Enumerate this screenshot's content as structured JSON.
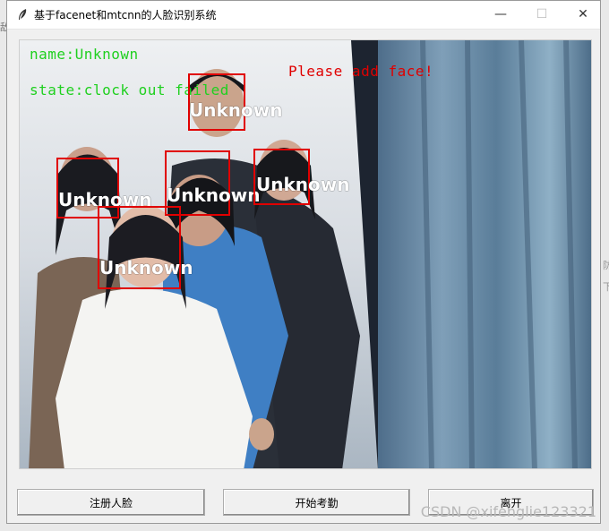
{
  "window": {
    "title": "基于facenet和mtcnn的人脸识别系统",
    "controls": {
      "minimize": "—",
      "maximize": "☐",
      "close": "✕"
    }
  },
  "video": {
    "overlay": {
      "name_text": "name:Unknown",
      "state_text": "state:clock out failed",
      "prompt_text": "Please add face!",
      "colors": {
        "name": "#20d020",
        "state": "#20d020",
        "prompt": "#e00000",
        "box": "#e00000",
        "label": "#ffffff"
      }
    },
    "faces": [
      {
        "label": "Unknown"
      },
      {
        "label": "Unknown"
      },
      {
        "label": "Unknown"
      },
      {
        "label": "Unknown"
      },
      {
        "label": "Unknown"
      }
    ]
  },
  "buttons": {
    "register": "注册人脸",
    "start": "开始考勤",
    "leave": "离开"
  },
  "watermark": "CSDN @xifenglie123321",
  "background_edge": {
    "left_char": "敌",
    "right_chars": [
      "防",
      "下"
    ]
  }
}
